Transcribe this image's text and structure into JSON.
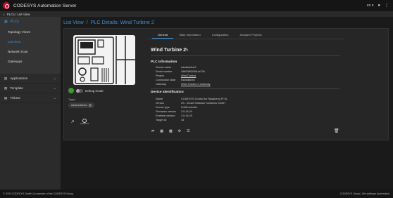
{
  "app": {
    "title": "CODESYS Automation Server"
  },
  "topbar": {
    "language": "en",
    "language_caret": "▾",
    "user_icon": "user-icon",
    "menu_icon": "menu-icon"
  },
  "breadcrumb": {
    "icon": "home-icon",
    "text": "PLCs / List View"
  },
  "sidebar": {
    "section": {
      "label": "PLCs",
      "icon": "plc-icon"
    },
    "items": [
      {
        "label": "Topology Views"
      },
      {
        "label": "List View"
      },
      {
        "label": "Network Scan"
      },
      {
        "label": "Gateways"
      }
    ],
    "groups": [
      {
        "label": "Applications",
        "icon": "apps-icon"
      },
      {
        "label": "Template",
        "icon": "template-icon"
      },
      {
        "label": "Tickets",
        "icon": "ticket-icon"
      }
    ]
  },
  "page": {
    "title_link": "List View",
    "separator": "/",
    "title_rest": "PLC Details: Wind Turbine 2"
  },
  "tabs": [
    {
      "label": "General"
    },
    {
      "label": "State Information"
    },
    {
      "label": "Configuration"
    },
    {
      "label": "Analyzer Projects"
    }
  ],
  "device": {
    "name": "Wind Turbine 2",
    "debug_label": "Debug mode",
    "tags_label": "Tag(s)",
    "tag": "wind turbines",
    "codesys_mini_text": "CODESYS"
  },
  "plc_info": {
    "heading": "PLC information",
    "rows": [
      {
        "k": "Device name",
        "v": "windturbine2"
      },
      {
        "k": "Serial number",
        "v": "1660080000b1a704"
      },
      {
        "k": "Project",
        "v": "WindTurbine"
      },
      {
        "k": "Connection state",
        "v": "Established"
      },
      {
        "k": "Gateway",
        "v": "Wind Turbine 2 Gateway"
      }
    ]
  },
  "device_id": {
    "heading": "Device Identification",
    "rows": [
      {
        "k": "Name",
        "v": "CODESYS Control for Raspberry Pi SL"
      },
      {
        "k": "Vendor",
        "v": "3S - Smart Software Solutions GmbH"
      },
      {
        "k": "Device type",
        "v": "SoftController"
      },
      {
        "k": "Firmware version",
        "v": "3.5.16.20"
      },
      {
        "k": "Runtime version",
        "v": "3.5.16.20"
      },
      {
        "k": "Target ID",
        "v": "16"
      }
    ]
  },
  "footer": {
    "left": "© 2020 CODESYS GmbH | A member of the CODESYS Group",
    "right": "CODESYS Group | We software Automation."
  },
  "colors": {
    "accent": "#3d8fd8",
    "status_green": "#3c9a2d",
    "brand_red": "#c8102e"
  }
}
